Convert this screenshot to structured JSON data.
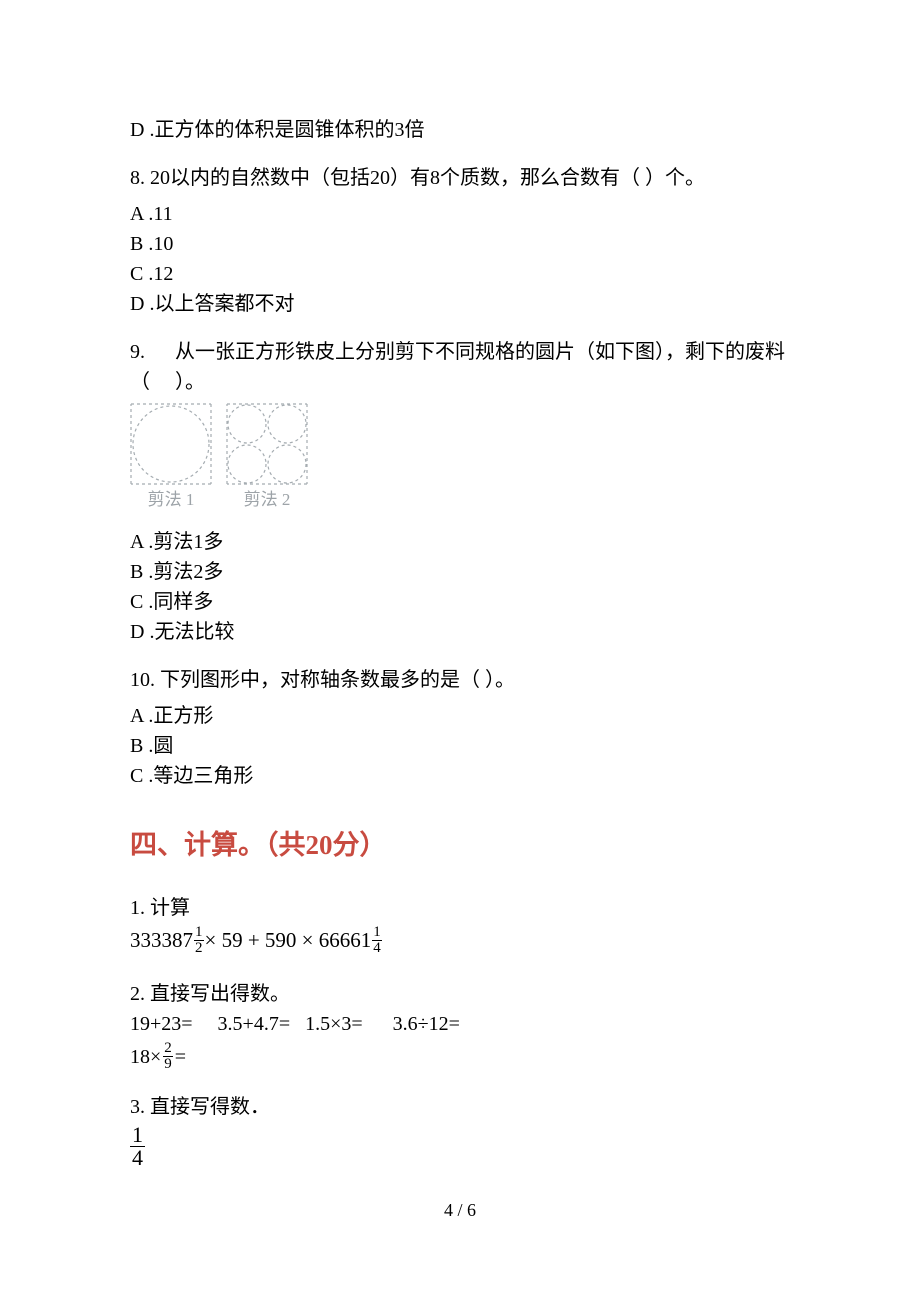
{
  "q7_optionD": "D .正方体的体积是圆锥体积的3倍",
  "q8": {
    "stem": "8.  20以内的自然数中（包括20）有8个质数，那么合数有（   ）个。",
    "a": "A .11",
    "b": "B .10",
    "c": "C .12",
    "d": "D .以上答案都不对"
  },
  "q9": {
    "stem": "9. 　 从一张正方形铁皮上分别剪下不同规格的圆片（如下图），剩下的废料（　 ）。",
    "cap1": "剪法 1",
    "cap2": "剪法 2",
    "a": "A .剪法1多",
    "b": "B .剪法2多",
    "c": "C .同样多",
    "d": "D .无法比较"
  },
  "q10": {
    "stem": "10.  下列图形中，对称轴条数最多的是（   ）。",
    "a": "A .正方形",
    "b": "B .圆",
    "c": "C .等边三角形"
  },
  "section4": "四、计算。（共20分）",
  "c1": {
    "stem": "1.  计算",
    "p1": "333387",
    "f1n": "1",
    "f1d": "2",
    "p2": " × 59 + 590 × 66661",
    "f2n": "1",
    "f2d": "4"
  },
  "c2": {
    "stem": "2.  直接写出得数。",
    "row1": "19+23=     3.5+4.7=   1.5×3=      3.6÷12=",
    "before": "18×",
    "fn": "2",
    "fd": "9",
    "after": " ="
  },
  "c3": {
    "stem": "3.  直接写得数．",
    "fn": "1",
    "fd": "4"
  },
  "pageNum": "4 / 6"
}
